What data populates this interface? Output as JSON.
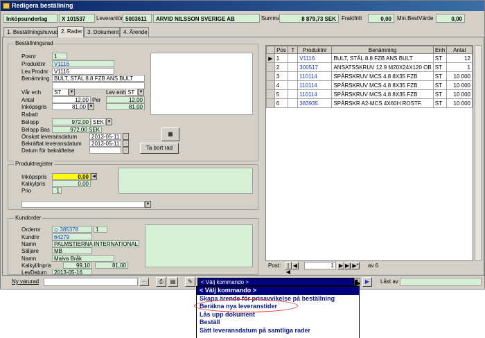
{
  "window": {
    "title": "Redigera beställning"
  },
  "header": {
    "doc_label": "Inköpsunderlag",
    "doc_no": "X  101537",
    "supplier_label": "Leverantör",
    "supplier_no": "5003611",
    "supplier_name": "ARVID NILSSON SVERIGE AB",
    "sum_label": "Summa",
    "sum_value": "8 879,73 SEK",
    "freight_label": "Fraktfritt",
    "freight_value": "0,00",
    "min_label": "Min.BestVärde",
    "min_value": "0,00"
  },
  "tabs": [
    "1. Beställningshuvud",
    "2. Rader",
    "3. Dokument",
    "4. Ärende"
  ],
  "orderrow": {
    "title": "Beställningsrad",
    "posnr_label": "Posnr",
    "posnr": "1",
    "produktnr_label": "Produktnr",
    "produktnr": "V1116",
    "levprodnr_label": "Lev.Prodnr",
    "levprodnr": "V1116",
    "benamning_label": "Benämning",
    "benamning": "BULT, STÅL 8.8 FZB ANS BULT",
    "var_enh_label": "Vår enh",
    "var_enh": "ST",
    "lev_enh_label": "Lev enh",
    "lev_enh": "ST",
    "antal_label": "Antal",
    "antal": "12,00",
    "per_label": "Per",
    "per": "12,00",
    "inkopspris_label": "Inköpsgris",
    "inkopspris": "81,00",
    "inkopspris2": "81,00",
    "rabatt_label": "Rabatt",
    "belopp_label": "Belopp",
    "belopp": "972,00",
    "belopp_cur": "SEK",
    "beloppbas_label": "Belopp Bas",
    "beloppbas": "972,00 SEK",
    "onskat_label": "Önskat leveransdatum",
    "onskat": "2013-05-11",
    "bekraftat_label": "Bekräftat leveransdatum",
    "bekraftat": "2013-05-11",
    "datum_label": "Datum för bekräftelse",
    "ta_bort": "Ta bort rad"
  },
  "product": {
    "title": "Produktregister",
    "inkopspris_label": "Inköpspris",
    "inkopspris": "0,00",
    "kalkyl_label": "Kalkylpris",
    "kalkyl": "0,00",
    "prio_label": "Prio",
    "prio": "1"
  },
  "customer": {
    "title": "Kundorder",
    "ordernr_label": "Ordernr",
    "ordernr": "385378",
    "orderpos": "1",
    "kundnr_label": "Kundnr",
    "kundnr": "64279",
    "namn_label": "Namn",
    "namn": "PALMSTIERNA  INTERNATIONAL AB",
    "saljare_label": "Säljare",
    "saljare": "MB",
    "namn2_label": "Namn",
    "namn2": "Malva Bråk",
    "kalkyl_label": "Kalkyl/Inpris",
    "kalkyl": "99,10",
    "inpris": "81,00",
    "levdatum_label": "LevDatum",
    "levdatum": "2013-05-16"
  },
  "grid": {
    "columns": [
      "Pos",
      "T",
      "Produktnr",
      "Benämning",
      "Enh",
      "Antal"
    ],
    "rows": [
      [
        "1",
        "",
        "V1116",
        "BULT, STÅL 8.8 FZB ANS BULT",
        "ST",
        "12"
      ],
      [
        "2",
        "",
        "300517",
        "ANSATSSKRUV 12.9 M20X24X120 OB",
        "ST",
        "1"
      ],
      [
        "3",
        "",
        "110114",
        "SPÅRSKRUV MCS 4.8  8X35    FZB",
        "ST",
        "10 000"
      ],
      [
        "4",
        "",
        "110114",
        "SPÅRSKRUV MCS 4.8  8X35    FZB",
        "ST",
        "10 000"
      ],
      [
        "5",
        "",
        "110114",
        "SPÅRSKRUV MCS 4.8  8X35    FZB",
        "ST",
        "10 000"
      ],
      [
        "6",
        "",
        "383935",
        "SPÅRSKR A2-MCS  4X60H ROSTF.",
        "ST",
        "10 000"
      ]
    ],
    "nav_label": "Post:",
    "nav_current": "1",
    "nav_total": "av  6"
  },
  "bottom": {
    "ny_varurad": "Ny varurad",
    "command": "< Välj kommando >",
    "last_av": "Låst av"
  },
  "dropdown": {
    "items": [
      "< Välj kommando >",
      "Skapa ärende för prisavvikelse på beställning",
      "Beräkna nya leveranstider",
      "Lås upp dokument",
      "Beställ",
      "Sätt leveransdatum på samtliga rader"
    ]
  }
}
